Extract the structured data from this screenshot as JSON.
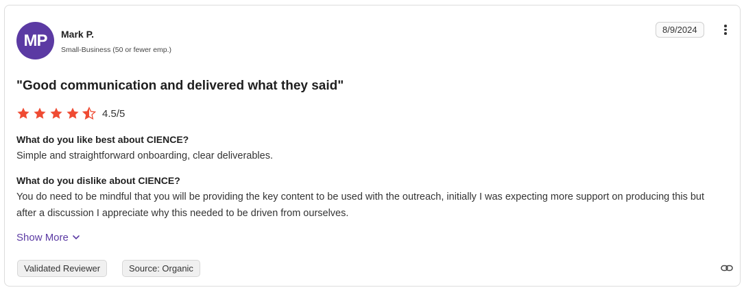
{
  "reviewer": {
    "initials": "MP",
    "name": "Mark P.",
    "segment": "Small-Business (50 or fewer emp.)"
  },
  "date": "8/9/2024",
  "review": {
    "title": "\"Good communication and delivered what they said\"",
    "rating": 4.5,
    "rating_max": 5,
    "rating_text": "4.5/5",
    "q1": "What do you like best about CIENCE?",
    "a1": "Simple and straightforward onboarding, clear deliverables.",
    "q2": "What do you dislike about CIENCE?",
    "a2": "You do need to be mindful that you will be providing the key content to be used with the outreach, initially I was expecting more support on producing this but after a discussion I appreciate why this needed to be driven from ourselves.",
    "show_more": "Show More"
  },
  "tags": [
    "Validated Reviewer",
    "Source: Organic"
  ],
  "colors": {
    "accent": "#5b3aa3",
    "star": "#ef4b33"
  },
  "icons": [
    "more-options-icon",
    "star-icon",
    "chevron-down-icon",
    "link-icon"
  ]
}
